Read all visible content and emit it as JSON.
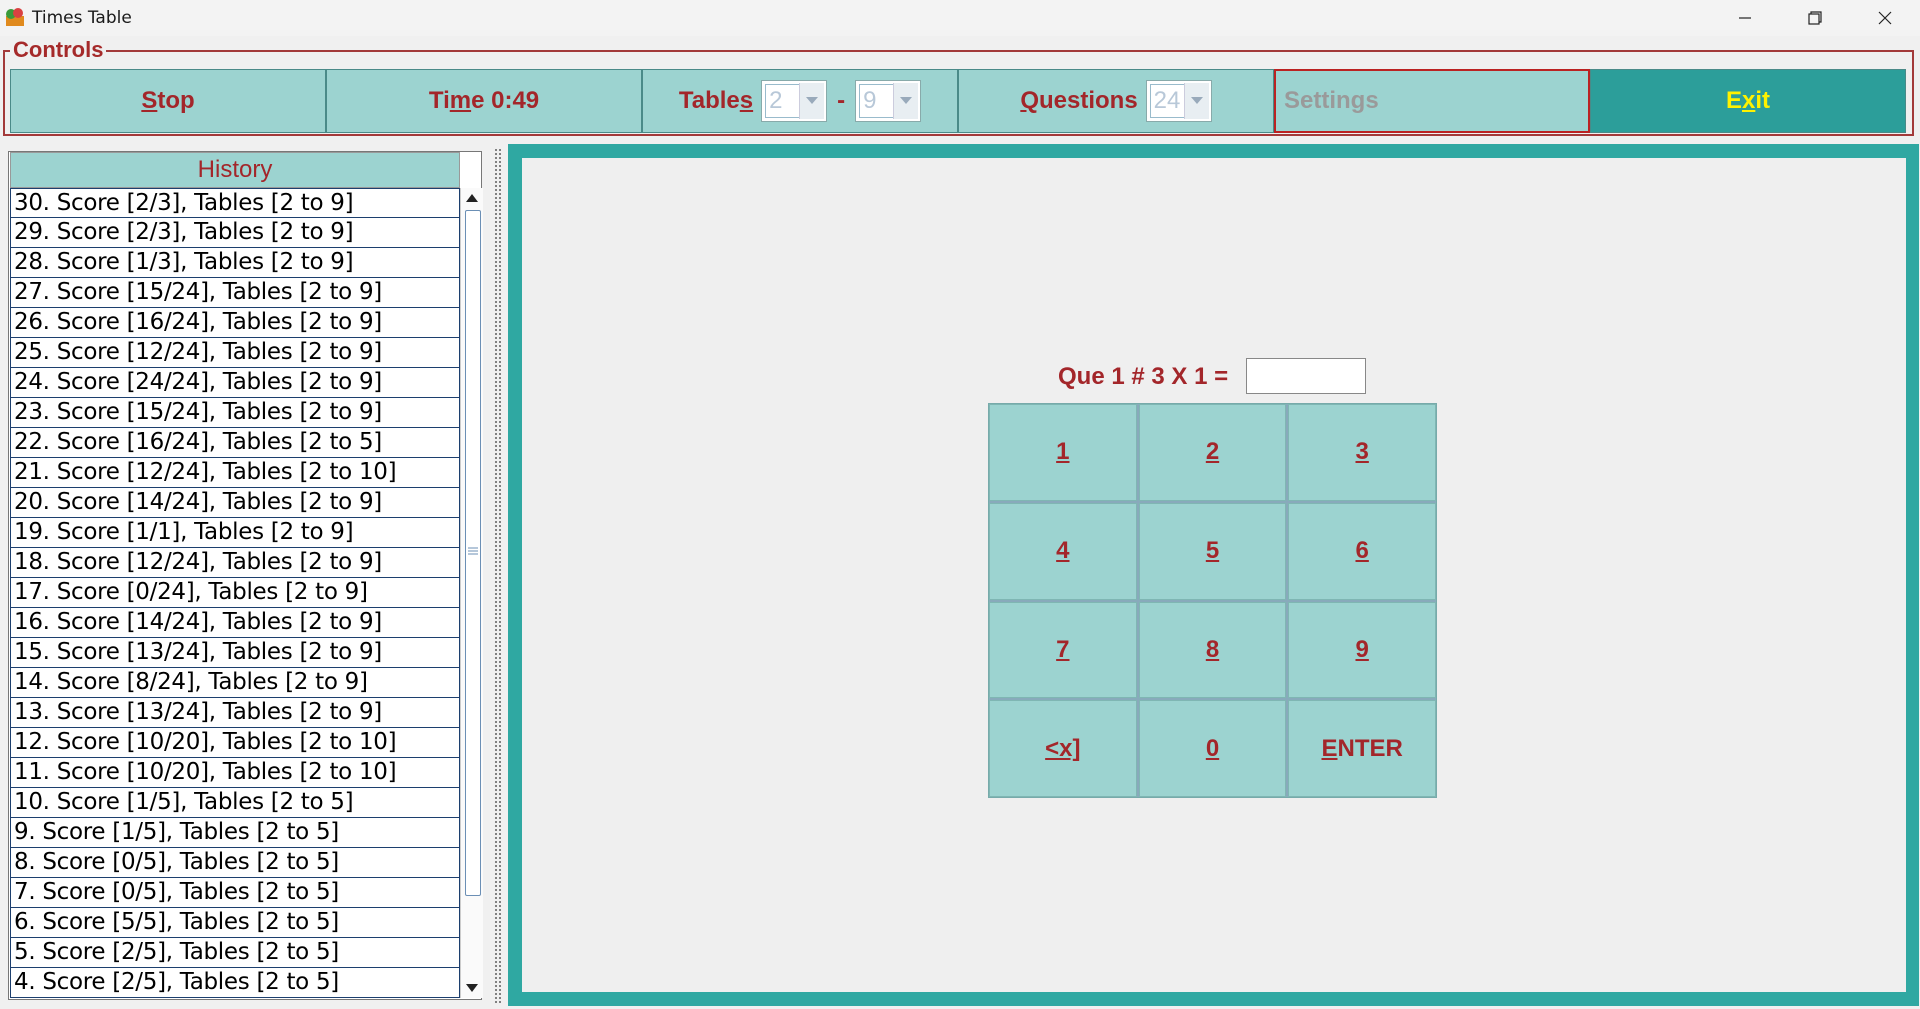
{
  "window": {
    "title": "Times Table"
  },
  "controls": {
    "legend": "Controls",
    "stop": {
      "first": "S",
      "rest": "top"
    },
    "time": {
      "pre": "Ti",
      "u": "m",
      "post": "e 0:49"
    },
    "tables": {
      "pre": "Table",
      "u": "s",
      "post": "",
      "from": "2",
      "to": "9",
      "separator": "-"
    },
    "questions": {
      "u": "Q",
      "rest": "uestions",
      "value": "24"
    },
    "settings": "Settings",
    "exit": {
      "pre": "E",
      "u": "x",
      "post": "it"
    }
  },
  "history": {
    "header": "History",
    "items": [
      "30. Score [2/3], Tables [2 to 9]",
      "29. Score [2/3], Tables [2 to 9]",
      "28. Score [1/3], Tables [2 to 9]",
      "27. Score [15/24], Tables [2 to 9]",
      "26. Score [16/24], Tables [2 to 9]",
      "25. Score [12/24], Tables [2 to 9]",
      "24. Score [24/24], Tables [2 to 9]",
      "23. Score [15/24], Tables [2 to 9]",
      "22. Score [16/24], Tables [2 to 5]",
      "21. Score [12/24], Tables [2 to 10]",
      "20. Score [14/24], Tables [2 to 9]",
      "19. Score [1/1], Tables [2 to 9]",
      "18. Score [12/24], Tables [2 to 9]",
      "17. Score [0/24], Tables [2 to 9]",
      "16. Score [14/24], Tables [2 to 9]",
      "15. Score [13/24], Tables [2 to 9]",
      "14. Score [8/24], Tables [2 to 9]",
      "13. Score [13/24], Tables [2 to 9]",
      "12. Score [10/20], Tables [2 to 10]",
      "11. Score [10/20], Tables [2 to 10]",
      "10. Score [1/5], Tables [2 to 5]",
      "9. Score [1/5], Tables [2 to 5]",
      "8. Score [0/5], Tables [2 to 5]",
      "7. Score [0/5], Tables [2 to 5]",
      "6. Score [5/5], Tables [2 to 5]",
      "5. Score [2/5], Tables [2 to 5]",
      "4. Score [2/5], Tables [2 to 5]"
    ]
  },
  "quiz": {
    "question": "Que 1 #  3 X 1 =",
    "answer": ""
  },
  "keypad": {
    "keys": [
      {
        "name": "key-1",
        "u": "1",
        "rest": ""
      },
      {
        "name": "key-2",
        "u": "2",
        "rest": ""
      },
      {
        "name": "key-3",
        "u": "3",
        "rest": ""
      },
      {
        "name": "key-4",
        "u": "4",
        "rest": ""
      },
      {
        "name": "key-5",
        "u": "5",
        "rest": ""
      },
      {
        "name": "key-6",
        "u": "6",
        "rest": ""
      },
      {
        "name": "key-7",
        "u": "7",
        "rest": ""
      },
      {
        "name": "key-8",
        "u": "8",
        "rest": ""
      },
      {
        "name": "key-9",
        "u": "9",
        "rest": ""
      },
      {
        "name": "key-backspace",
        "u": "<x]",
        "rest": ""
      },
      {
        "name": "key-0",
        "u": "0",
        "rest": ""
      },
      {
        "name": "key-enter",
        "u": "E",
        "rest": "NTER"
      }
    ]
  },
  "colors": {
    "accent": "#a3262a",
    "panel": "#9cd3d0",
    "frame": "#2fa8a2",
    "exit_text": "#fff200"
  }
}
